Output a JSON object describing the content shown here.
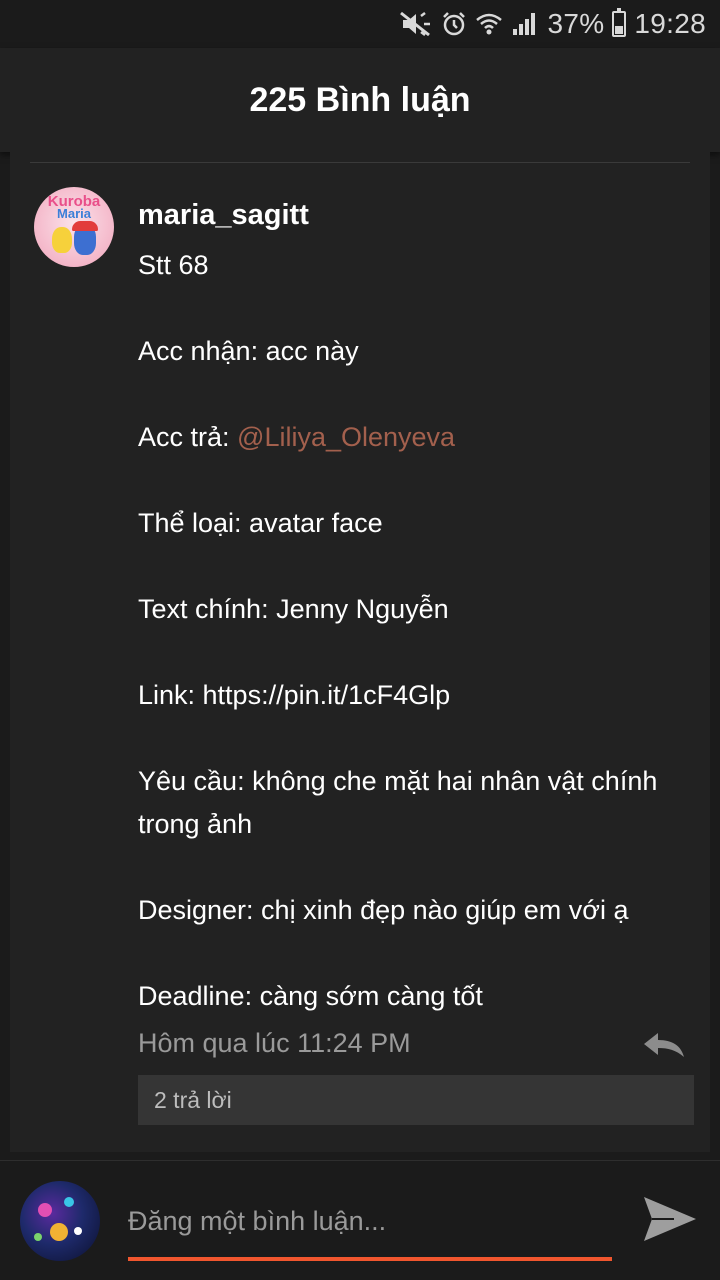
{
  "status_bar": {
    "battery_percent": "37%",
    "battery_level": 0.37,
    "time": "19:28",
    "icons": [
      "mute-icon",
      "alarm-icon",
      "wifi-icon",
      "signal-icon",
      "battery-icon"
    ]
  },
  "header": {
    "title": "225 Bình luận"
  },
  "comment": {
    "username": "maria_sagitt",
    "avatar_text_top": "Kuroba",
    "avatar_text_bottom": "Maria",
    "lines": [
      {
        "text": "Stt 68"
      },
      {
        "text": ""
      },
      {
        "text": "Acc nhận: acc này"
      },
      {
        "text": ""
      },
      {
        "prefix": "Acc trả: ",
        "mention": "@Liliya_Olenyeva"
      },
      {
        "text": ""
      },
      {
        "text": "Thể loại: avatar face"
      },
      {
        "text": ""
      },
      {
        "text": "Text chính: Jenny Nguyễn"
      },
      {
        "text": ""
      },
      {
        "text": "Link: https://pin.it/1cF4Glp"
      },
      {
        "text": ""
      },
      {
        "text": "Yêu cầu: không che mặt hai nhân vật chính trong ảnh"
      },
      {
        "text": ""
      },
      {
        "text": "Designer: chị xinh đẹp nào giúp em với ạ"
      },
      {
        "text": ""
      },
      {
        "text": "Deadline: càng sớm càng tốt"
      }
    ],
    "timestamp": "Hôm qua lúc 11:24 PM",
    "replies_label": "2 trả lời"
  },
  "composer": {
    "placeholder": "Đăng một bình luận...",
    "value": ""
  },
  "colors": {
    "background": "#1b1b1b",
    "panel": "#222222",
    "mention": "#a3604d",
    "accent": "#f0562e",
    "muted_text": "#9a9a9a"
  }
}
